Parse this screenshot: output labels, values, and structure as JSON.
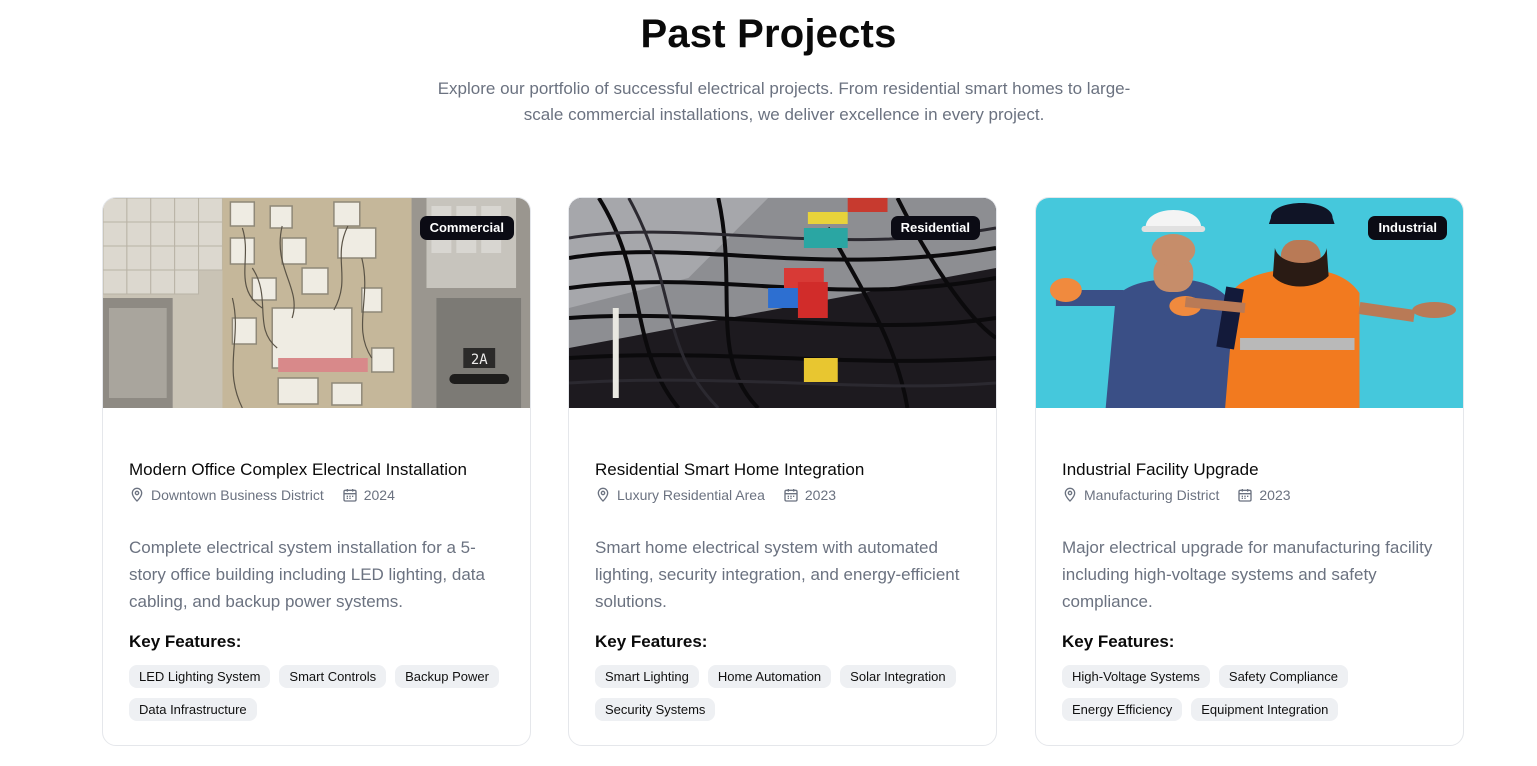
{
  "header": {
    "title": "Past Projects",
    "subtitle": "Explore our portfolio of successful electrical projects. From residential smart homes to large-scale commercial installations, we deliver excellence in every project."
  },
  "key_features_label": "Key Features:",
  "colors": {
    "badge_bg": "#0b0b14",
    "tag_bg": "#eef0f3",
    "muted_text": "#6b7280"
  },
  "projects": [
    {
      "category": "Commercial",
      "title": "Modern Office Complex Electrical Installation",
      "location": "Downtown Business District",
      "year": "2024",
      "description": "Complete electrical system installation for a 5-story office building including LED lighting, data cabling, and backup power systems.",
      "features": [
        "LED Lighting System",
        "Smart Controls",
        "Backup Power",
        "Data Infrastructure"
      ]
    },
    {
      "category": "Residential",
      "title": "Residential Smart Home Integration",
      "location": "Luxury Residential Area",
      "year": "2023",
      "description": "Smart home electrical system with automated lighting, security integration, and energy-efficient solutions.",
      "features": [
        "Smart Lighting",
        "Home Automation",
        "Solar Integration",
        "Security Systems"
      ]
    },
    {
      "category": "Industrial",
      "title": "Industrial Facility Upgrade",
      "location": "Manufacturing District",
      "year": "2023",
      "description": "Major electrical upgrade for manufacturing facility including high-voltage systems and safety compliance.",
      "features": [
        "High-Voltage Systems",
        "Safety Compliance",
        "Energy Efficiency",
        "Equipment Integration"
      ]
    }
  ],
  "image_labels": {
    "panel_tag": "2A"
  }
}
